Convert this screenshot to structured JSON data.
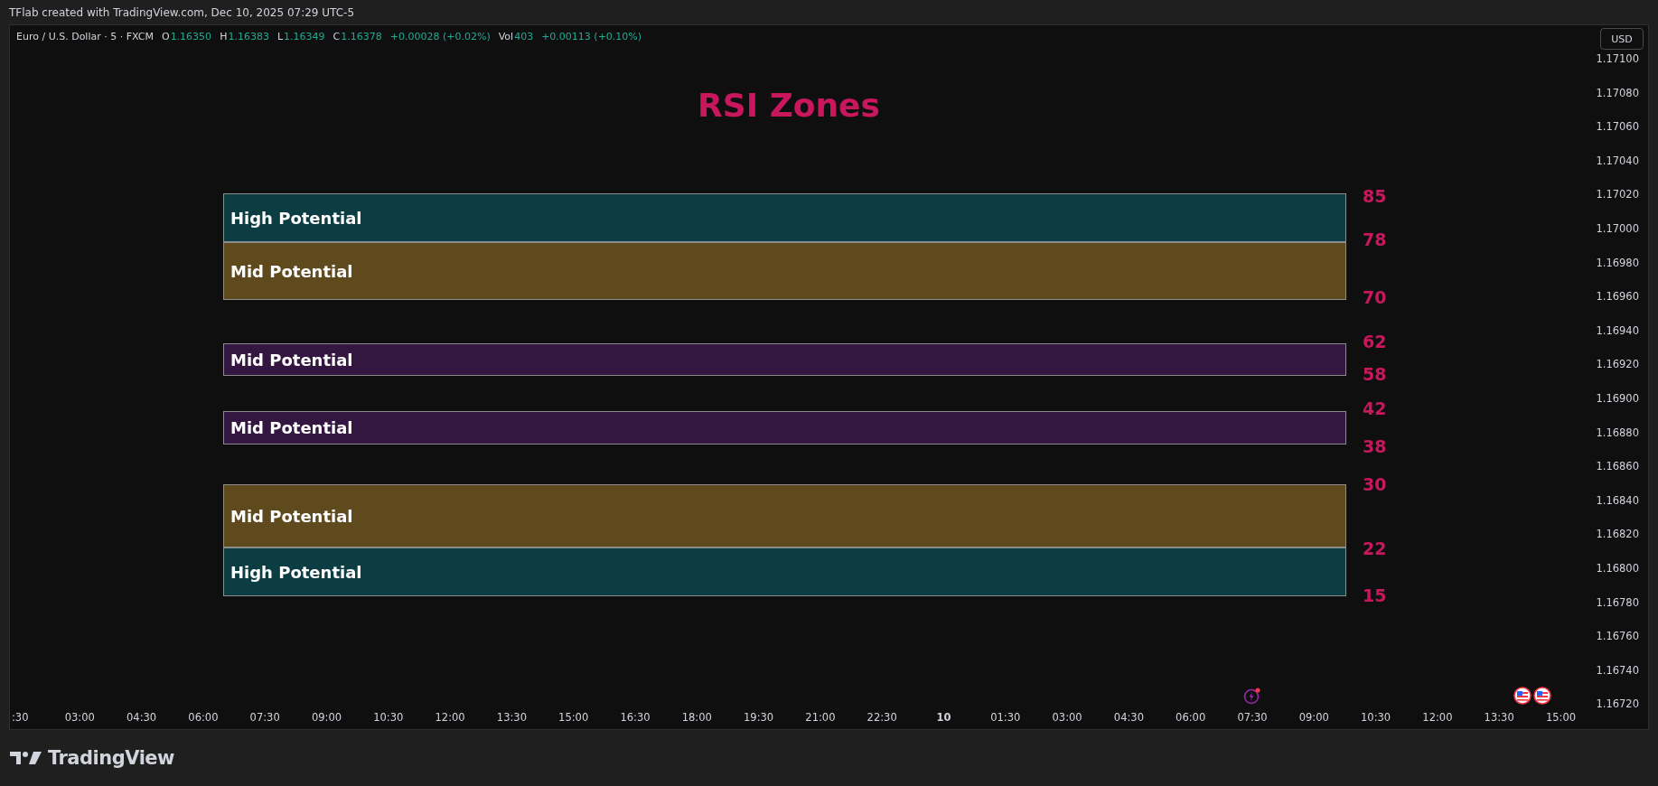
{
  "header": "TFlab created with TradingView.com, Dec 10, 2025 07:29 UTC-5",
  "legend": {
    "symbol": "Euro / U.S. Dollar · 5 · FXCM",
    "ohlc": [
      {
        "label": "O",
        "value": "1.16350"
      },
      {
        "label": "H",
        "value": "1.16383"
      },
      {
        "label": "L",
        "value": "1.16349"
      },
      {
        "label": "C",
        "value": "1.16378"
      }
    ],
    "change": "+0.00028 (+0.02%)",
    "volume_label": "Vol",
    "volume": "403",
    "volume_change": "+0.00113 (+0.10%)"
  },
  "currency_button": "USD",
  "chart": {
    "title": "RSI Zones",
    "zones": [
      {
        "label": "High Potential",
        "color": "#0b3d42"
      },
      {
        "label": "Mid Potential",
        "color": "#5e4a1c"
      },
      {
        "label": "Mid Potential",
        "color": "#341741"
      },
      {
        "label": "Mid Potential",
        "color": "#341741"
      },
      {
        "label": "Mid Potential",
        "color": "#5e4a1c"
      },
      {
        "label": "High Potential",
        "color": "#0b3d42"
      }
    ],
    "levels": [
      "85",
      "78",
      "70",
      "62",
      "58",
      "42",
      "38",
      "30",
      "22",
      "15"
    ]
  },
  "price_axis": [
    "1.17100",
    "1.17080",
    "1.17060",
    "1.17040",
    "1.17020",
    "1.17000",
    "1.16980",
    "1.16960",
    "1.16940",
    "1.16920",
    "1.16900",
    "1.16880",
    "1.16860",
    "1.16840",
    "1.16820",
    "1.16800",
    "1.16780",
    "1.16760",
    "1.16740",
    "1.16720"
  ],
  "time_axis": [
    {
      "label": ":30",
      "bold": false
    },
    {
      "label": "03:00",
      "bold": false
    },
    {
      "label": "04:30",
      "bold": false
    },
    {
      "label": "06:00",
      "bold": false
    },
    {
      "label": "07:30",
      "bold": false
    },
    {
      "label": "09:00",
      "bold": false
    },
    {
      "label": "10:30",
      "bold": false
    },
    {
      "label": "12:00",
      "bold": false
    },
    {
      "label": "13:30",
      "bold": false
    },
    {
      "label": "15:00",
      "bold": false
    },
    {
      "label": "16:30",
      "bold": false
    },
    {
      "label": "18:00",
      "bold": false
    },
    {
      "label": "19:30",
      "bold": false
    },
    {
      "label": "21:00",
      "bold": false
    },
    {
      "label": "22:30",
      "bold": false
    },
    {
      "label": "10",
      "bold": true
    },
    {
      "label": "01:30",
      "bold": false
    },
    {
      "label": "03:00",
      "bold": false
    },
    {
      "label": "04:30",
      "bold": false
    },
    {
      "label": "06:00",
      "bold": false
    },
    {
      "label": "07:30",
      "bold": false
    },
    {
      "label": "09:00",
      "bold": false
    },
    {
      "label": "10:30",
      "bold": false
    },
    {
      "label": "12:00",
      "bold": false
    },
    {
      "label": "13:30",
      "bold": false
    },
    {
      "label": "15:00",
      "bold": false
    }
  ],
  "footer": {
    "brand": "TradingView"
  }
}
